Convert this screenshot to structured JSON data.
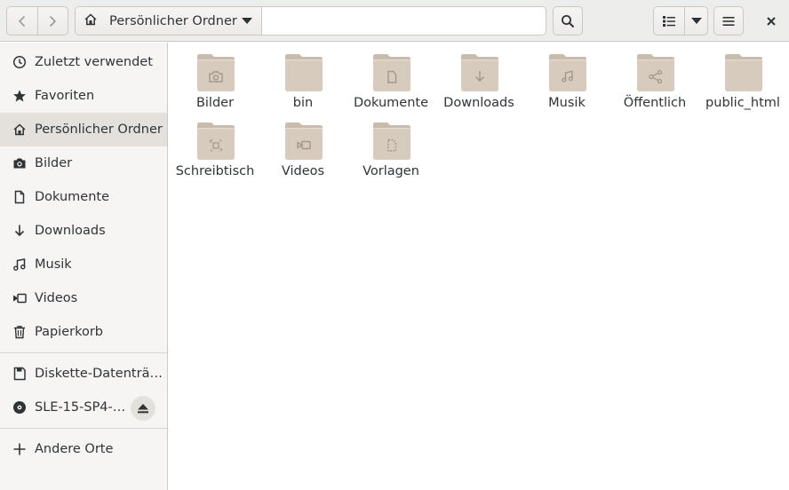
{
  "header": {
    "location_label": "Persönlicher Ordner"
  },
  "sidebar": {
    "items": [
      {
        "label": "Zuletzt verwendet",
        "icon": "clock-icon"
      },
      {
        "label": "Favoriten",
        "icon": "star-icon"
      },
      {
        "label": "Persönlicher Ordner",
        "icon": "home-icon",
        "active": true
      },
      {
        "label": "Bilder",
        "icon": "camera-icon"
      },
      {
        "label": "Dokumente",
        "icon": "document-icon"
      },
      {
        "label": "Downloads",
        "icon": "download-icon"
      },
      {
        "label": "Musik",
        "icon": "music-icon"
      },
      {
        "label": "Videos",
        "icon": "video-icon"
      },
      {
        "label": "Papierkorb",
        "icon": "trash-icon"
      }
    ],
    "devices": [
      {
        "label": "Diskette-Datenträ…",
        "icon": "drive-icon"
      },
      {
        "label": "SLE-15-SP4-…",
        "icon": "disc-icon"
      }
    ],
    "other_locations": {
      "label": "Andere Orte",
      "icon": "plus-icon"
    }
  },
  "folders": [
    {
      "name": "Bilder",
      "emblem": "camera"
    },
    {
      "name": "bin",
      "emblem": "none"
    },
    {
      "name": "Dokumente",
      "emblem": "document"
    },
    {
      "name": "Downloads",
      "emblem": "download"
    },
    {
      "name": "Musik",
      "emblem": "music"
    },
    {
      "name": "Öffentlich",
      "emblem": "share"
    },
    {
      "name": "public_html",
      "emblem": "none"
    },
    {
      "name": "Schreibtisch",
      "emblem": "desktop"
    },
    {
      "name": "Videos",
      "emblem": "video"
    },
    {
      "name": "Vorlagen",
      "emblem": "template"
    }
  ],
  "colors": {
    "folder_body": "#d7cbbd",
    "folder_tab": "#c9bcad",
    "emblem": "#a3978a"
  }
}
